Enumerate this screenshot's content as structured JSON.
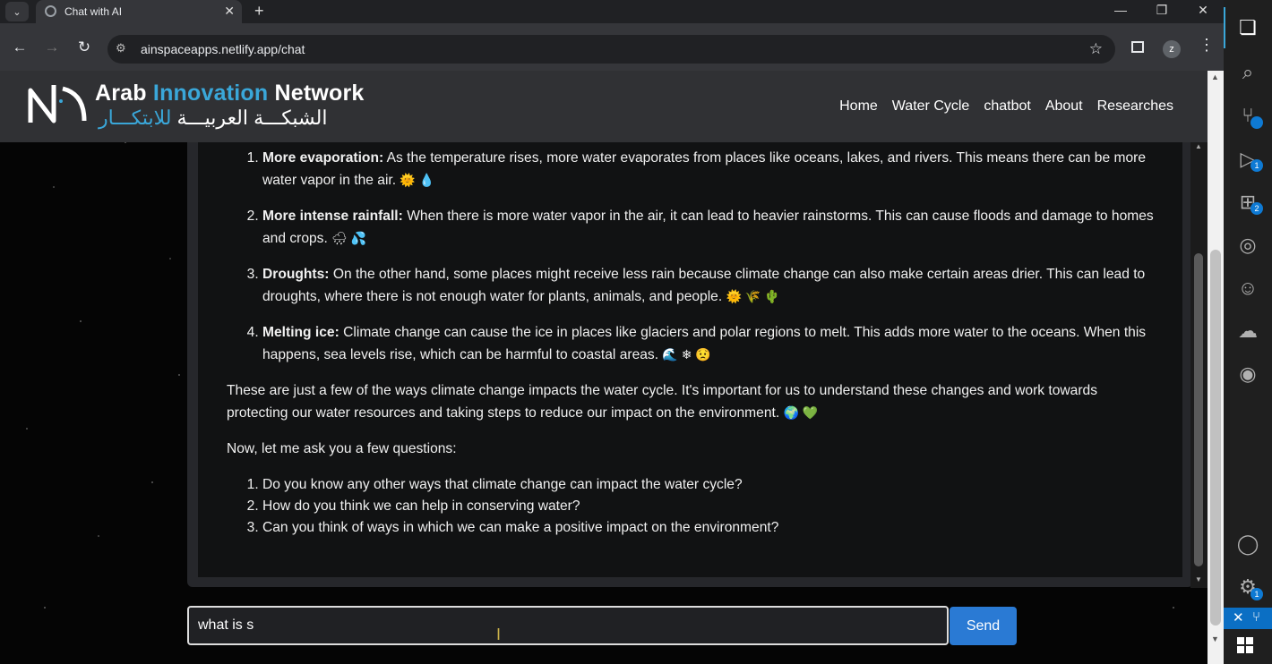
{
  "browser": {
    "tab_title": "Chat with AI",
    "url": "ainspaceapps.netlify.app/chat",
    "profile_initial": "z",
    "icons": [
      "tab-search-icon",
      "new-tab-icon",
      "minimize-icon",
      "restore-icon",
      "close-window-icon",
      "back-icon",
      "forward-icon",
      "reload-icon",
      "site-info-icon",
      "bookmark-star-icon",
      "side-panel-icon",
      "menu-kebab-icon"
    ]
  },
  "site": {
    "logo_en": {
      "w1": "Arab",
      "w2": "Innovation",
      "w3": "Network"
    },
    "logo_ar": {
      "a1": "الشبكـــة العربيـــة",
      "a2": "للابتكـــار"
    },
    "nav": [
      "Home",
      "Water Cycle",
      "chatbot",
      "About",
      "Researches"
    ]
  },
  "chat": {
    "impacts": [
      {
        "title": "More evaporation:",
        "text": "As the temperature rises, more water evaporates from places like oceans, lakes, and rivers. This means there can be more water vapor in the air. ",
        "emoji": "🌞 💧"
      },
      {
        "title": "More intense rainfall:",
        "text": "When there is more water vapor in the air, it can lead to heavier rainstorms. This can cause floods and damage to homes and crops. ",
        "emoji": "🌧 💦"
      },
      {
        "title": "Droughts:",
        "text": "On the other hand, some places might receive less rain because climate change can also make certain areas drier. This can lead to droughts, where there is not enough water for plants, animals, and people. ",
        "emoji": "🌞 🌾 🌵"
      },
      {
        "title": "Melting ice:",
        "text": "Climate change can cause the ice in places like glaciers and polar regions to melt. This adds more water to the oceans. When this happens, sea levels rise, which can be harmful to coastal areas. ",
        "emoji": "🌊 ❄ 😟"
      }
    ],
    "summary": "These are just a few of the ways climate change impacts the water cycle. It's important for us to understand these changes and work towards protecting our water resources and taking steps to reduce our impact on the environment. ",
    "summary_emoji": "🌍 💚",
    "question_intro": "Now, let me ask you a few questions:",
    "questions": [
      "Do you know any other ways that climate change can impact the water cycle?",
      "How do you think we can help in conserving water?",
      "Can you think of ways in which we can make a positive impact on the environment?"
    ]
  },
  "composer": {
    "value": "what is s",
    "send_label": "Send"
  },
  "activity_bar": {
    "icons": [
      "explorer-icon",
      "search-icon",
      "source-control-icon",
      "run-debug-icon",
      "extensions-icon",
      "git-graph-icon",
      "copilot-icon",
      "cloud-icon",
      "remote-explorer-icon",
      "accounts-icon",
      "settings-gear-icon"
    ],
    "badges": {
      "source_control": "",
      "run_debug": "1",
      "extensions": "2",
      "settings": "1"
    }
  },
  "colors": {
    "accent": "#3aa7d9",
    "send": "#2a7ad4",
    "navbar": "#303134"
  }
}
